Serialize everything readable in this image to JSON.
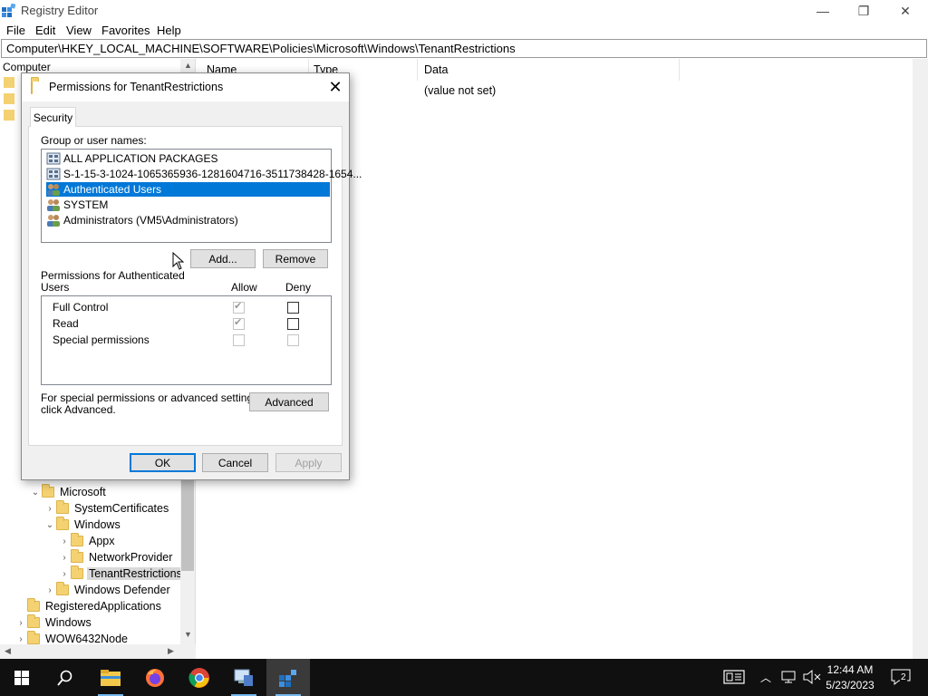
{
  "window": {
    "title": "Registry Editor",
    "minimize_glyph": "—",
    "maximize_glyph": "❐",
    "close_glyph": "✕"
  },
  "menu": [
    "File",
    "Edit",
    "View",
    "Favorites",
    "Help"
  ],
  "address": "Computer\\HKEY_LOCAL_MACHINE\\SOFTWARE\\Policies\\Microsoft\\Windows\\TenantRestrictions",
  "tree": {
    "header": "Computer",
    "items": [
      {
        "label": "Microsoft",
        "expander": "expanded"
      },
      {
        "label": "SystemCertificates",
        "expander": "collapsed"
      },
      {
        "label": "Windows",
        "expander": "expanded"
      },
      {
        "label": "Appx",
        "expander": "collapsed"
      },
      {
        "label": "NetworkProvider",
        "expander": "collapsed"
      },
      {
        "label": "TenantRestrictions",
        "expander": "collapsed",
        "selected": true
      },
      {
        "label": "Windows Defender",
        "expander": "collapsed"
      },
      {
        "label": "RegisteredApplications",
        "expander": "none"
      },
      {
        "label": "Windows",
        "expander": "collapsed"
      },
      {
        "label": "WOW6432Node",
        "expander": "collapsed"
      }
    ]
  },
  "list": {
    "columns": [
      "Name",
      "Type",
      "Data"
    ],
    "rows": [
      {
        "data": "(value not set)"
      }
    ]
  },
  "dialog": {
    "title": "Permissions for TenantRestrictions",
    "tab": "Security",
    "group_label": "Group or user names:",
    "users": [
      {
        "name": "ALL APPLICATION PACKAGES",
        "icon": "package-icon"
      },
      {
        "name": "S-1-15-3-1024-1065365936-1281604716-3511738428-1654...",
        "icon": "package-icon"
      },
      {
        "name": "Authenticated Users",
        "icon": "users-icon",
        "selected": true
      },
      {
        "name": "SYSTEM",
        "icon": "users-icon"
      },
      {
        "name": "Administrators (VM5\\Administrators)",
        "icon": "users-icon"
      }
    ],
    "add_label": "Add...",
    "remove_label": "Remove",
    "perm_for_line1": "Permissions for Authenticated",
    "perm_for_line2": "Users",
    "allow_header": "Allow",
    "deny_header": "Deny",
    "permissions": [
      {
        "name": "Full Control",
        "allow": true,
        "allow_disabled": true,
        "deny": false,
        "deny_disabled": false
      },
      {
        "name": "Read",
        "allow": true,
        "allow_disabled": true,
        "deny": false,
        "deny_disabled": false
      },
      {
        "name": "Special permissions",
        "allow": false,
        "allow_disabled": true,
        "deny": false,
        "deny_disabled": true
      }
    ],
    "advanced_text_line1": "For special permissions or advanced settings,",
    "advanced_text_line2": "click Advanced.",
    "advanced_label": "Advanced",
    "ok_label": "OK",
    "cancel_label": "Cancel",
    "apply_label": "Apply"
  },
  "taskbar": {
    "time": "12:44 AM",
    "date": "5/23/2023",
    "notification_count": "2",
    "accent": "#0078d7"
  }
}
